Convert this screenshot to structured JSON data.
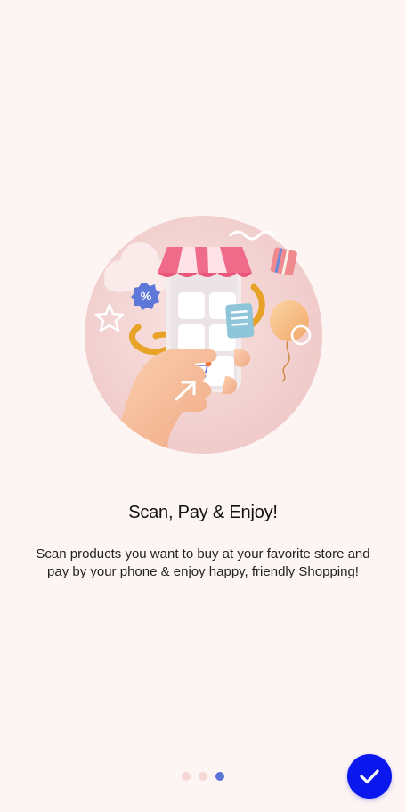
{
  "onboarding": {
    "title": "Scan, Pay & Enjoy!",
    "description": "Scan products you want to buy at your favorite store and pay by your phone & enjoy happy, friendly Shopping!",
    "illustration_badge": "%",
    "page_indicator": {
      "total": 3,
      "current": 3
    }
  },
  "colors": {
    "background": "#fdf5f3",
    "accent": "#0a18ee",
    "active_dot": "#5b74d8",
    "inactive_dot": "#f7d6d8"
  },
  "icons": {
    "done": "checkmark-icon",
    "illustration": "shopping-phone-illustration"
  }
}
